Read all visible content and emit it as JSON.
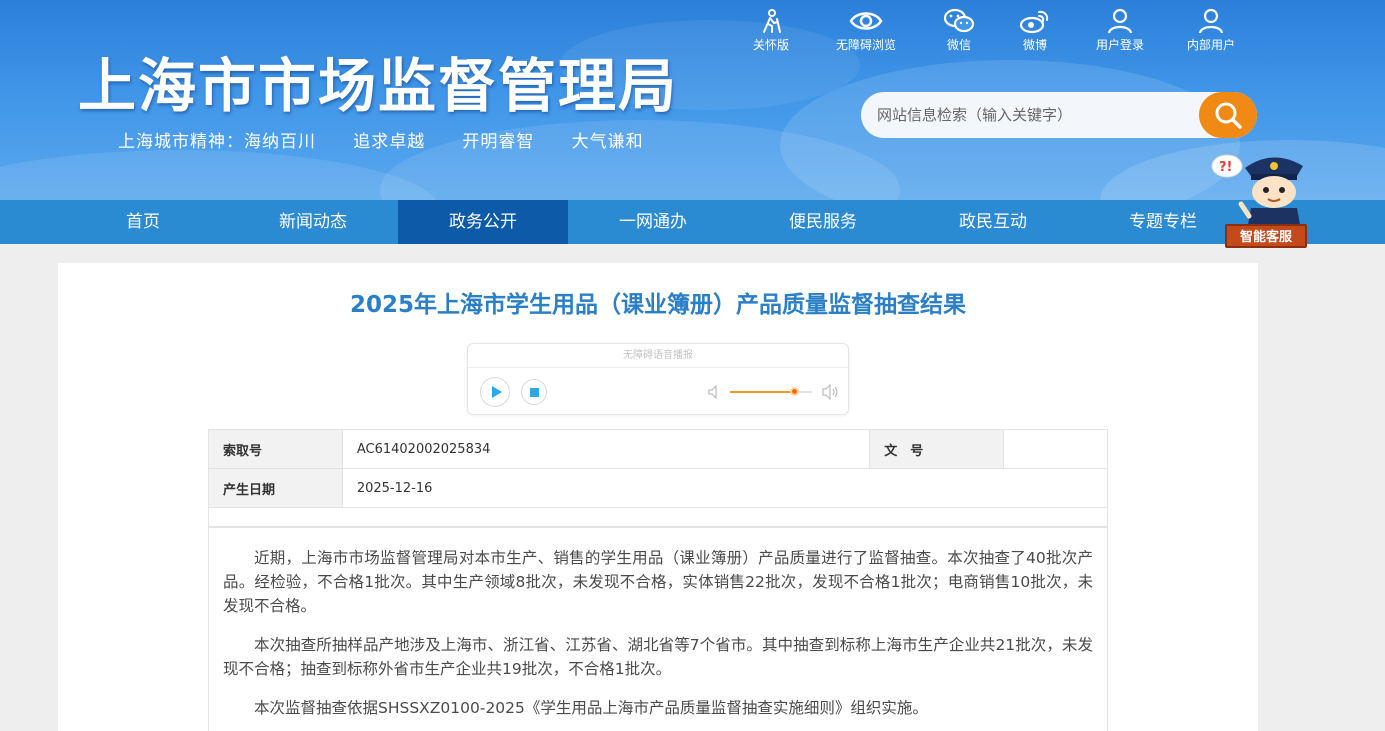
{
  "header": {
    "site_title": "上海市市场监督管理局",
    "slogan": "上海城市精神：海纳百川   追求卓越   开明睿智   大气谦和",
    "tools": [
      {
        "label": "关怀版",
        "icon": "elderly-care-icon"
      },
      {
        "label": "无障碍浏览",
        "icon": "eye-icon"
      },
      {
        "label": "微信",
        "icon": "wechat-icon"
      },
      {
        "label": "微博",
        "icon": "weibo-icon"
      },
      {
        "label": "用户登录",
        "icon": "user-icon"
      },
      {
        "label": "内部用户",
        "icon": "user-icon"
      }
    ],
    "search_placeholder": "网站信息检索（输入关键字）"
  },
  "nav": {
    "items": [
      "首页",
      "新闻动态",
      "政务公开",
      "一网通办",
      "便民服务",
      "政民互动",
      "专题专栏"
    ],
    "active_index": 2
  },
  "mascot": {
    "label": "智能客服"
  },
  "article": {
    "title": "2025年上海市学生用品（课业簿册）产品质量监督抽查结果",
    "player": {
      "title": "无障碍语音播报",
      "volume": 0.78
    },
    "meta": {
      "index_label": "索取号",
      "index_value": "AC61402002025834",
      "doc_no_label": "文　号",
      "doc_no_value": "",
      "date_label": "产生日期",
      "date_value": "2025-12-16"
    },
    "paragraphs": [
      "近期，上海市市场监督管理局对本市生产、销售的学生用品（课业簿册）产品质量进行了监督抽查。本次抽查了40批次产品。经检验，不合格1批次。其中生产领域8批次，未发现不合格，实体销售22批次，发现不合格1批次；电商销售10批次，未发现不合格。",
      "本次抽查所抽样品产地涉及上海市、浙江省、江苏省、湖北省等7个省市。其中抽查到标称上海市生产企业共21批次，未发现不合格；抽查到标称外省市生产企业共19批次，不合格1批次。",
      "本次监督抽查依据SHSSXZ0100-2025《学生用品上海市产品质量监督抽查实施细则》组织实施。"
    ]
  },
  "colors": {
    "header_blue": "#3f95e8",
    "nav_blue": "#2a8ad2",
    "nav_active": "#0d5ba8",
    "search_orange": "#f08a15",
    "title_blue": "#2a7fc6"
  }
}
